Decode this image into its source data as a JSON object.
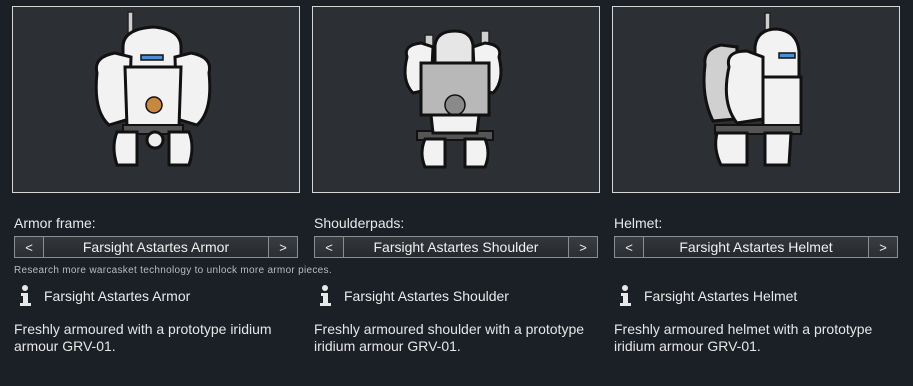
{
  "hint": "Research more warcasket technology to unlock more armor pieces.",
  "columns": [
    {
      "slot_label": "Armor frame:",
      "prev_label": "<",
      "next_label": ">",
      "selected": "Farsight Astartes Armor",
      "item_name": "Farsight Astartes Armor",
      "description": "Freshly armoured with a prototype iridium armour GRV-01.",
      "info_icon": "info-icon"
    },
    {
      "slot_label": "Shoulderpads:",
      "prev_label": "<",
      "next_label": ">",
      "selected": "Farsight Astartes Shoulder",
      "item_name": "Farsight Astartes Shoulder",
      "description": "Freshly armoured shoulder with a prototype iridium armour GRV-01.",
      "info_icon": "info-icon"
    },
    {
      "slot_label": "Helmet:",
      "prev_label": "<",
      "next_label": ">",
      "selected": "Farsight Astartes Helmet",
      "item_name": "Farsight Astartes Helmet",
      "description": "Freshly armoured helmet with a prototype iridium armour GRV-01.",
      "info_icon": "info-icon"
    }
  ],
  "colors": {
    "background": "#1b1f26",
    "preview_bg": "#2c2f33",
    "armor_white": "#f2f2f2",
    "armor_grey": "#b8b8b8",
    "visor_blue": "#4a8fd6",
    "emblem_orange": "#c8893f"
  }
}
